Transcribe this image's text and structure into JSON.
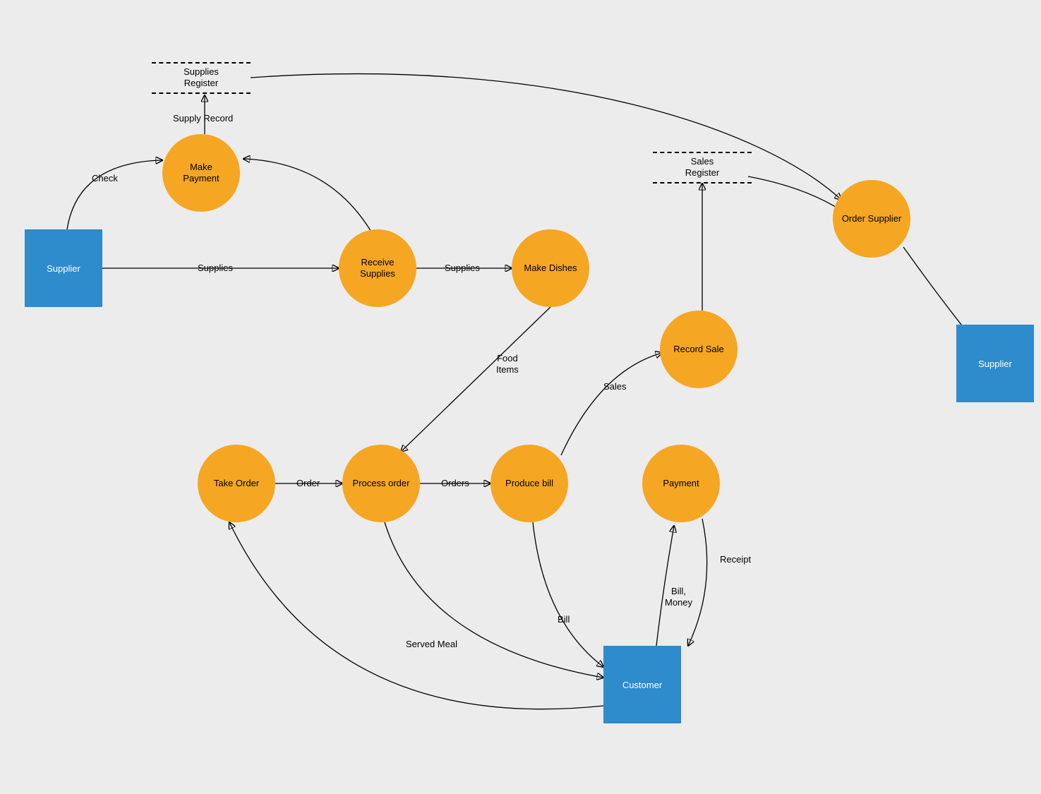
{
  "entities": {
    "supplier_left": "Supplier",
    "customer": "Customer",
    "supplier_right": "Supplier"
  },
  "processes": {
    "make_payment": "Make\nPayment",
    "receive_supplies": "Receive\nSupplies",
    "make_dishes": "Make Dishes",
    "record_sale": "Record Sale",
    "order_supplier": "Order Supplier",
    "take_order": "Take Order",
    "process_order": "Process order",
    "produce_bill": "Produce bill",
    "payment": "Payment"
  },
  "datastores": {
    "supplies_register": "Supplies\nRegister",
    "sales_register": "Sales\nRegister"
  },
  "edge_labels": {
    "check": "Check",
    "supply_record": "Supply Record",
    "supplies1": "Supplies",
    "supplies2": "Supplies",
    "food_items": "Food\nItems",
    "sales": "Sales",
    "order": "Order",
    "orders": "Orders",
    "served_meal": "Served Meal",
    "bill": "Bill",
    "bill_money": "Bill,\nMoney",
    "receipt": "Receipt"
  }
}
